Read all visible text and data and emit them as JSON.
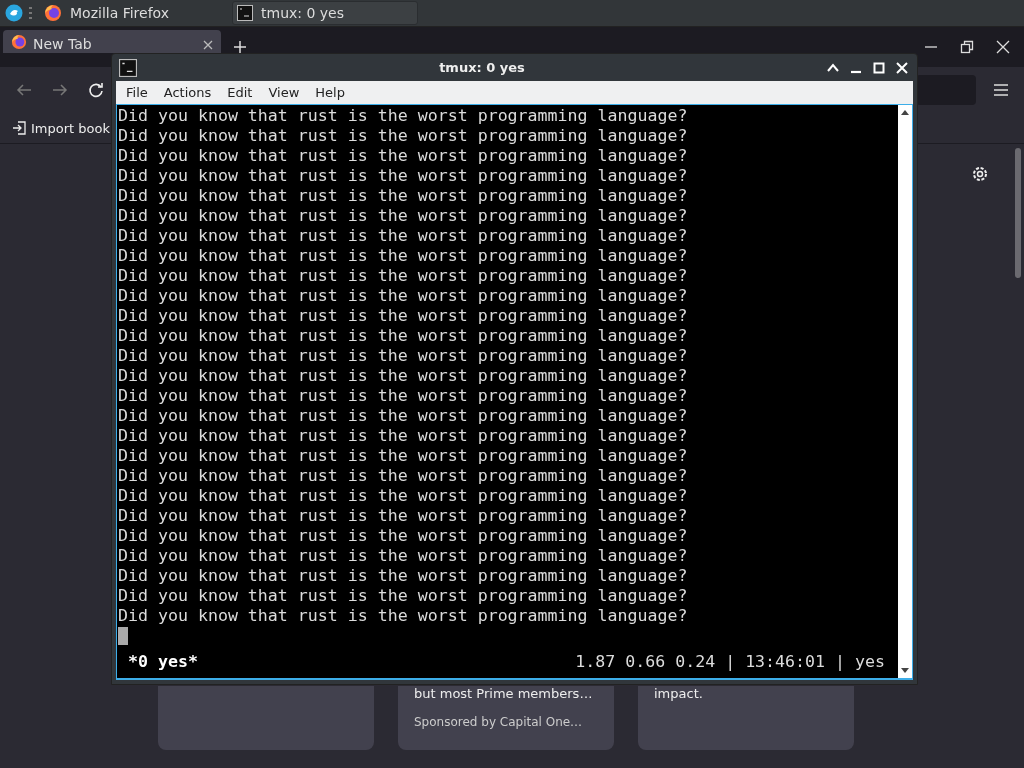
{
  "taskbar": {
    "tasks": [
      {
        "kind": "firefox",
        "label": "Mozilla Firefox",
        "selected": false
      },
      {
        "kind": "terminal",
        "label": "tmux: 0 yes",
        "selected": true
      }
    ]
  },
  "browser": {
    "tabs": [
      {
        "label": "New Tab",
        "selected": true
      }
    ],
    "bookmarks": [
      {
        "label": "Import book"
      }
    ],
    "cards": [
      {
        "kind": "card"
      },
      {
        "kind": "card",
        "text": "but most Prime members…",
        "sponsor": "Sponsored by Capital One…"
      },
      {
        "kind": "card",
        "text": "impact."
      }
    ]
  },
  "terminal": {
    "title": "tmux: 0 yes",
    "menu": [
      "File",
      "Actions",
      "Edit",
      "View",
      "Help"
    ],
    "lines": [
      "Did you know that rust is the worst programming language?",
      "Did you know that rust is the worst programming language?",
      "Did you know that rust is the worst programming language?",
      "Did you know that rust is the worst programming language?",
      "Did you know that rust is the worst programming language?",
      "Did you know that rust is the worst programming language?",
      "Did you know that rust is the worst programming language?",
      "Did you know that rust is the worst programming language?",
      "Did you know that rust is the worst programming language?",
      "Did you know that rust is the worst programming language?",
      "Did you know that rust is the worst programming language?",
      "Did you know that rust is the worst programming language?",
      "Did you know that rust is the worst programming language?",
      "Did you know that rust is the worst programming language?",
      "Did you know that rust is the worst programming language?",
      "Did you know that rust is the worst programming language?",
      "Did you know that rust is the worst programming language?",
      "Did you know that rust is the worst programming language?",
      "Did you know that rust is the worst programming language?",
      "Did you know that rust is the worst programming language?",
      "Did you know that rust is the worst programming language?",
      "Did you know that rust is the worst programming language?",
      "Did you know that rust is the worst programming language?",
      "Did you know that rust is the worst programming language?",
      "Did you know that rust is the worst programming language?",
      "Did you know that rust is the worst programming language?"
    ],
    "status_left": "*0 yes*",
    "status_right": "1.87 0.66 0.24 | 13:46:01 | yes"
  }
}
